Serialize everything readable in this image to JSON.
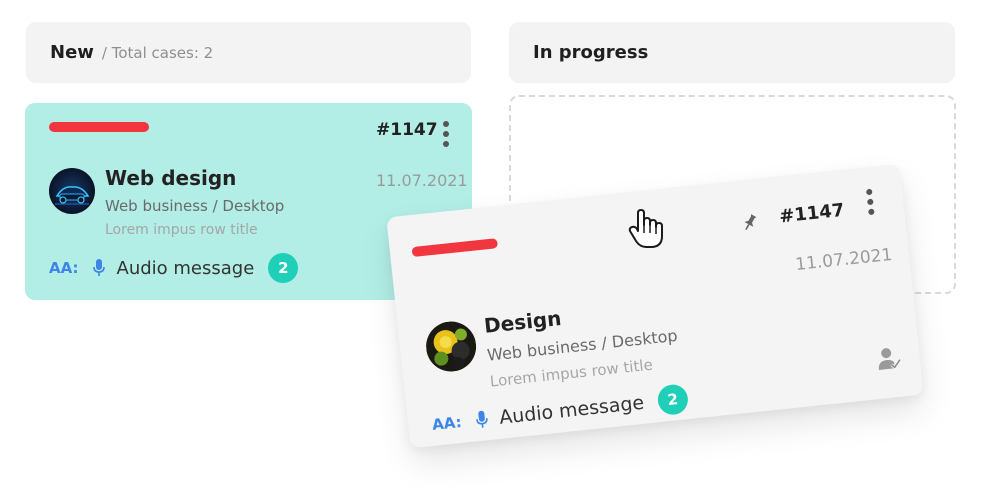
{
  "columns": {
    "new": {
      "title": "New",
      "subtitle": "/ Total cases: 2"
    },
    "in_progress": {
      "title": "In progress"
    }
  },
  "cards": [
    {
      "case_no": "#1147",
      "date": "11.07.2021",
      "title": "Web design",
      "subtitle": "Web business / Desktop",
      "description": "Lorem impus row title",
      "aa_label": "AA:",
      "audio_label": "Audio message",
      "badge": "2",
      "background": "#b2ede6",
      "avatar_icon": "neon-car-avatar"
    },
    {
      "case_no": "#1147",
      "date": "11.07.2021",
      "title": "Design",
      "subtitle": "Web business / Desktop",
      "description": "Lorem impus row title",
      "aa_label": "AA:",
      "audio_label": "Audio message",
      "badge": "2",
      "background": "#f4f4f4",
      "avatar_icon": "fruit-avatar"
    }
  ],
  "colors": {
    "priority": "#f1363f",
    "accent_blue": "#3b86e6",
    "badge": "#1fcfb8"
  },
  "icons": [
    "kebab-menu-icon",
    "microphone-icon",
    "pin-icon",
    "user-check-icon",
    "hand-cursor-icon"
  ]
}
